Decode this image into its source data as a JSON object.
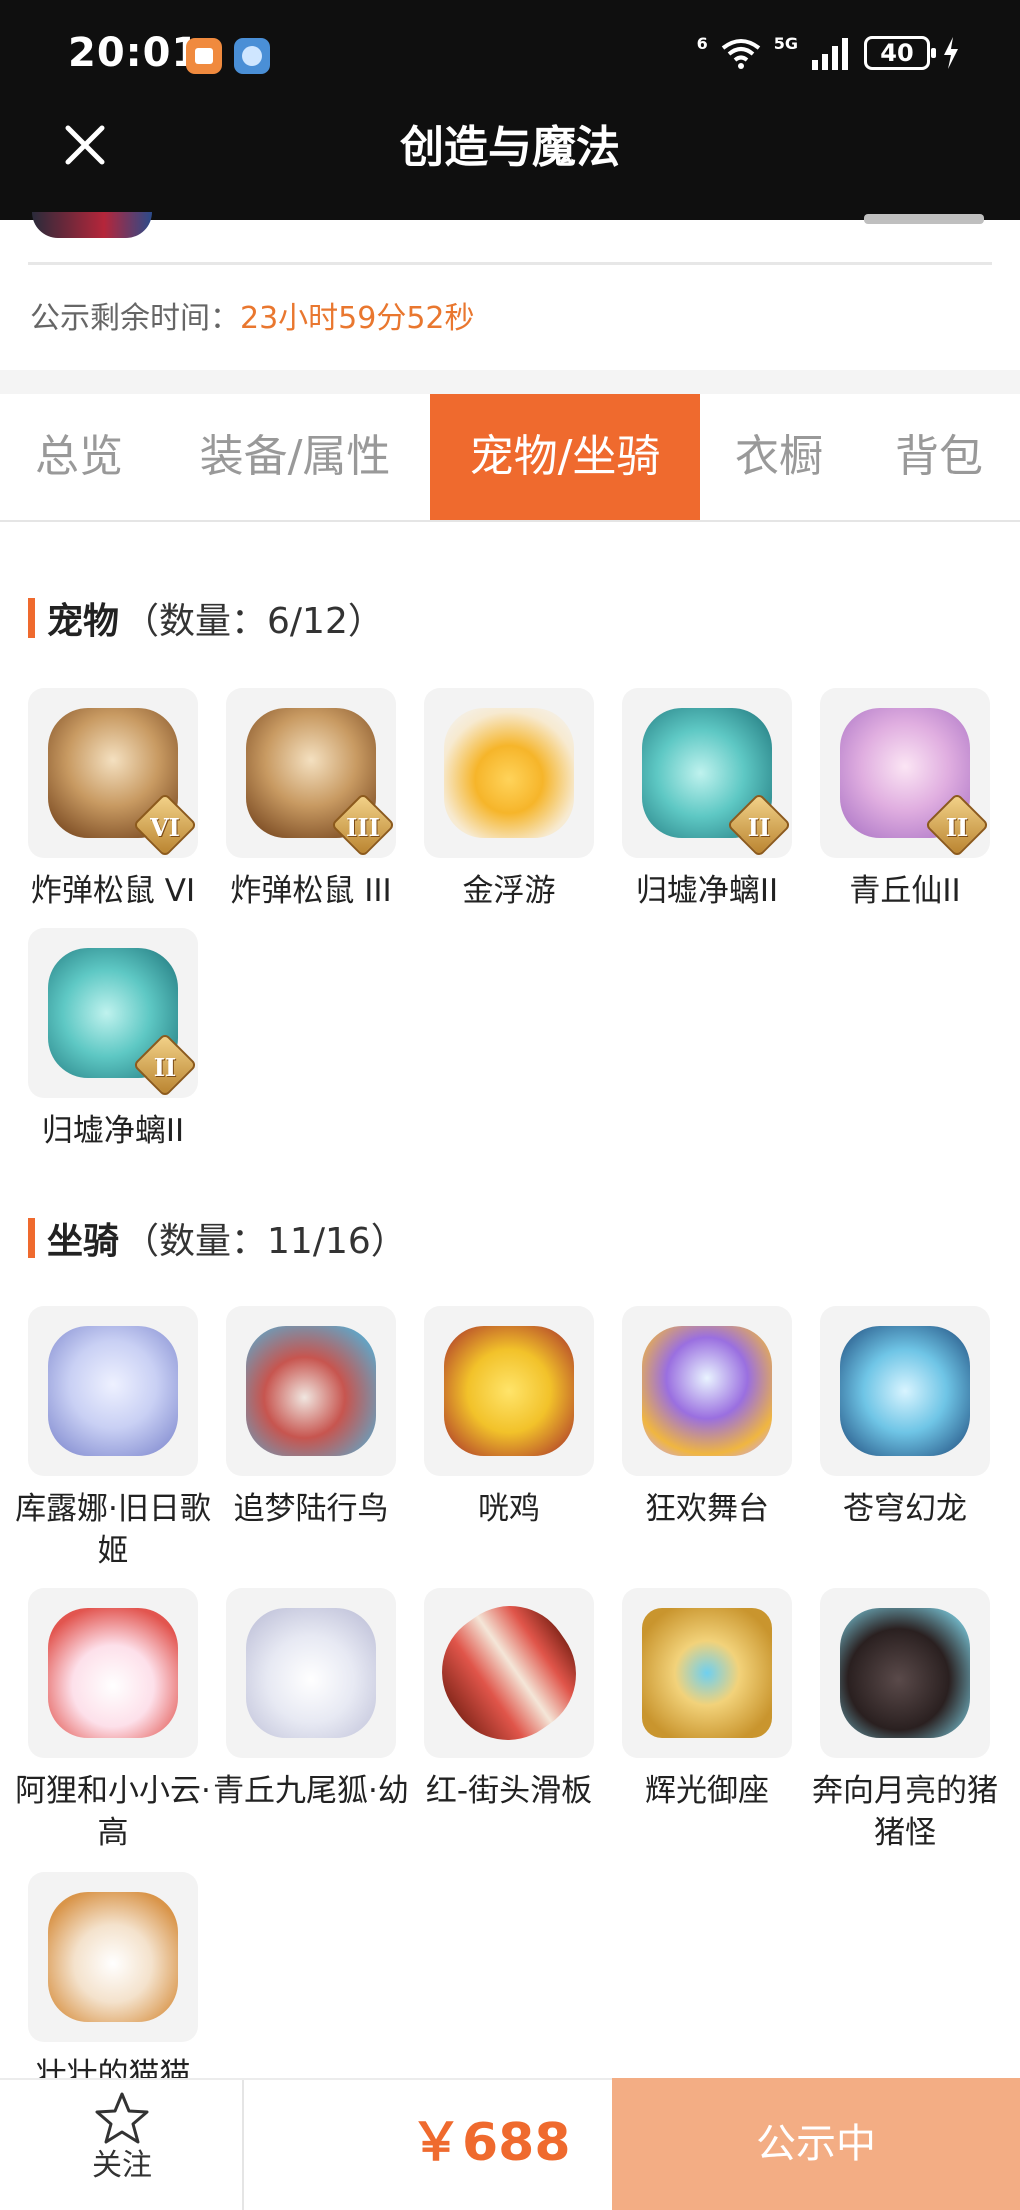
{
  "status_bar": {
    "time": "20:01",
    "signal_text": "6",
    "network_text": "5G",
    "battery": "40",
    "icons": [
      "app-notification-orange",
      "app-notification-blue",
      "wifi-icon",
      "cellular-signal-icon",
      "battery-icon",
      "charging-bolt-icon"
    ]
  },
  "header": {
    "title": "创造与魔法",
    "close_icon": "close-icon"
  },
  "countdown": {
    "label": "公示剩余时间：",
    "value": "23小时59分52秒"
  },
  "tabs": [
    {
      "label": "总览",
      "active": false
    },
    {
      "label": "装备/属性",
      "active": false
    },
    {
      "label": "宠物/坐骑",
      "active": true
    },
    {
      "label": "衣橱",
      "active": false
    },
    {
      "label": "背包",
      "active": false
    }
  ],
  "pets": {
    "title": "宠物",
    "count": "（数量：6/12）",
    "items": [
      {
        "name": "炸弹松鼠 VI",
        "badge": "VI",
        "icon": "squirrel-icon"
      },
      {
        "name": "炸弹松鼠 III",
        "badge": "III",
        "icon": "squirrel-icon"
      },
      {
        "name": "金浮游",
        "badge": "",
        "icon": "golden-dragon-icon"
      },
      {
        "name": "归墟净螭II",
        "badge": "II",
        "icon": "cyan-dragon-icon"
      },
      {
        "name": "青丘仙II",
        "badge": "II",
        "icon": "fox-fairy-icon"
      },
      {
        "name": "归墟净螭II",
        "badge": "II",
        "icon": "cyan-dragon-icon"
      }
    ]
  },
  "mounts": {
    "title": "坐骑",
    "count": "（数量：11/16）",
    "items": [
      {
        "name": "库露娜·旧日歌姬",
        "icon": "singer-icon"
      },
      {
        "name": "追梦陆行鸟",
        "icon": "bird-icon"
      },
      {
        "name": "咣鸡",
        "icon": "chicken-icon"
      },
      {
        "name": "狂欢舞台",
        "icon": "stage-icon"
      },
      {
        "name": "苍穹幻龙",
        "icon": "sky-dragon-icon"
      },
      {
        "name": "阿狸和小小云·高",
        "icon": "ali-cloud-icon"
      },
      {
        "name": "青丘九尾狐·幼",
        "icon": "nine-tail-fox-icon"
      },
      {
        "name": "红-街头滑板",
        "icon": "skateboard-icon"
      },
      {
        "name": "辉光御座",
        "icon": "throne-icon"
      },
      {
        "name": "奔向月亮的猪猪怪",
        "icon": "pig-icon"
      },
      {
        "name": "壮壮的猫猫",
        "icon": "cat-icon"
      }
    ]
  },
  "bottom_bar": {
    "follow_label": "关注",
    "price": "￥688",
    "status_button": "公示中"
  },
  "colors": {
    "accent": "#ef6a2e",
    "status_button": "#f3ad84",
    "header_bg": "#0f0f0f",
    "tile_bg": "#f3f3f3"
  }
}
